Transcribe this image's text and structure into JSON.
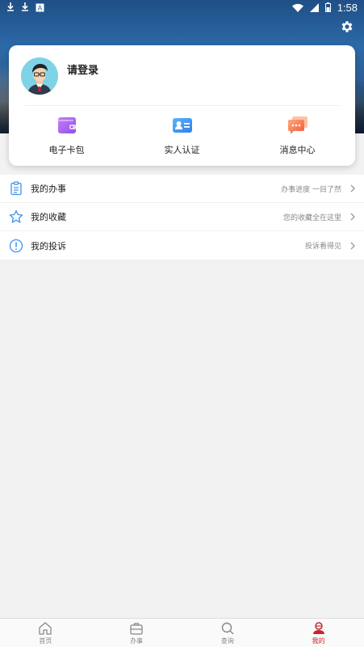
{
  "status_bar": {
    "time": "1:58",
    "icons": [
      "download-icon",
      "download-icon",
      "app-icon",
      "wifi-icon",
      "signal-icon",
      "battery-icon"
    ]
  },
  "header": {
    "settings_icon": "gear-icon"
  },
  "profile": {
    "login_prompt": "请登录"
  },
  "quick_actions": [
    {
      "label": "电子卡包",
      "icon": "wallet-icon",
      "color": "#a66bf0"
    },
    {
      "label": "实人认证",
      "icon": "id-card-icon",
      "color": "#3a93f0"
    },
    {
      "label": "消息中心",
      "icon": "message-icon",
      "color": "#f57a4a"
    }
  ],
  "menu": [
    {
      "label": "我的办事",
      "hint": "办事进度 一目了然",
      "icon": "clipboard-icon"
    },
    {
      "label": "我的收藏",
      "hint": "您的收藏全在这里",
      "icon": "star-icon"
    },
    {
      "label": "我的投诉",
      "hint": "投诉看得见",
      "icon": "alert-icon"
    }
  ],
  "tabs": [
    {
      "label": "首页",
      "icon": "home-icon",
      "active": false
    },
    {
      "label": "办事",
      "icon": "briefcase-icon",
      "active": false
    },
    {
      "label": "查询",
      "icon": "search-icon",
      "active": false
    },
    {
      "label": "我的",
      "icon": "user-icon",
      "active": true
    }
  ],
  "colors": {
    "accent": "#c8232c",
    "menu_icon": "#3a93f0"
  }
}
